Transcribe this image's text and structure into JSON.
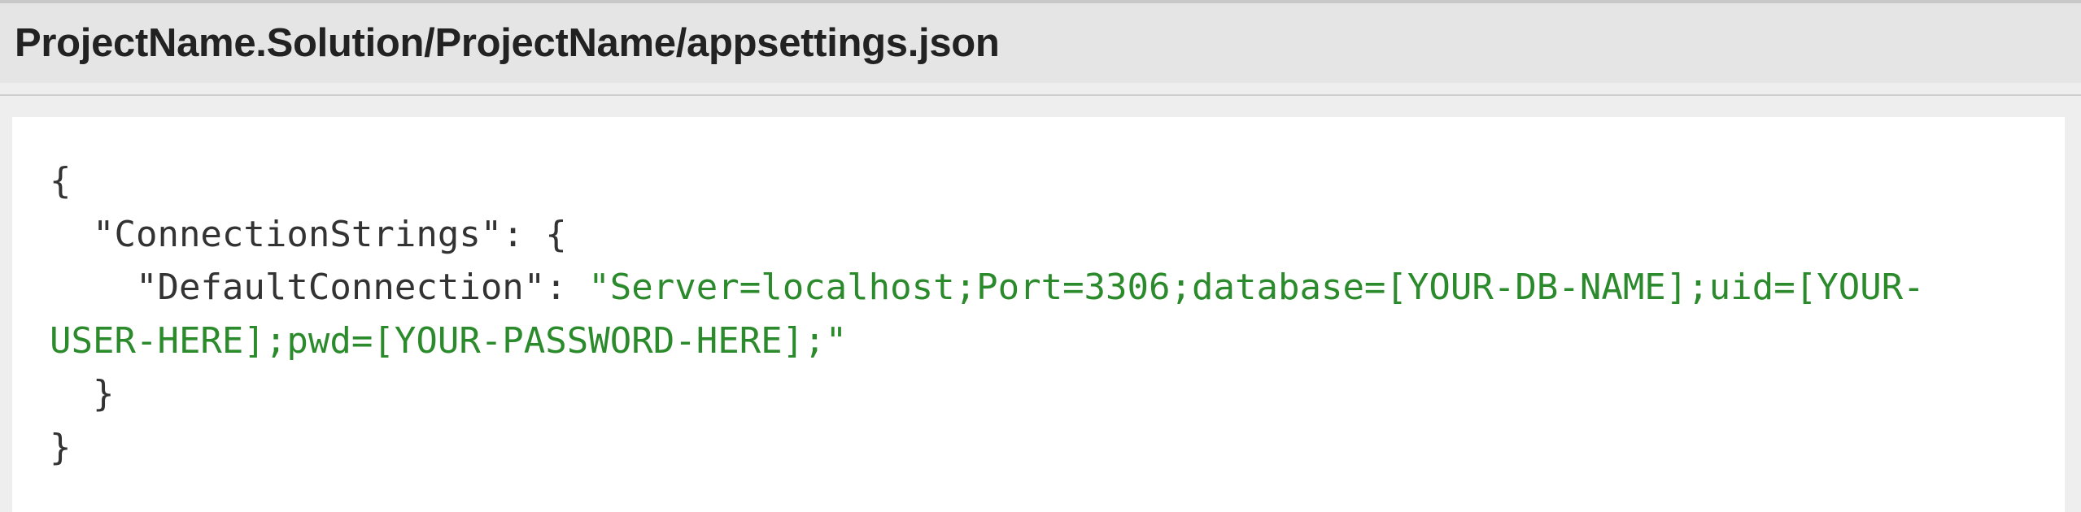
{
  "file": {
    "path": "ProjectName.Solution/ProjectName/appsettings.json"
  },
  "code": {
    "open_brace": "{",
    "key_connection_strings": "\"ConnectionStrings\"",
    "colon_open": ": {",
    "key_default_connection": "\"DefaultConnection\"",
    "colon_sep": ": ",
    "value_part1": "\"Server=localhost;Port=3306;database=[YOUR-DB-NAME];uid=[YOUR-",
    "value_part2": "USER-HERE];pwd=[YOUR-PASSWORD-HERE];\"",
    "inner_close": "}",
    "outer_close": "}"
  },
  "colors": {
    "string": "#2b8a2b",
    "text": "#333333",
    "header_bg": "#e5e5e5"
  }
}
